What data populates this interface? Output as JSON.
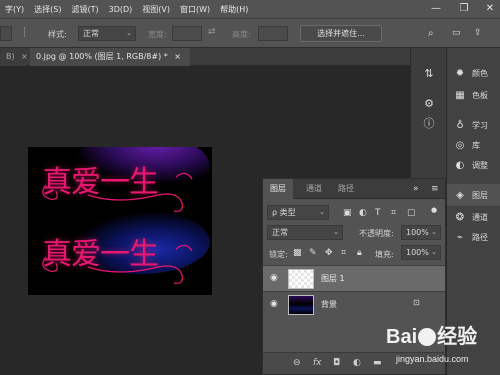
{
  "menu": {
    "items": [
      "字(Y)",
      "选择(S)",
      "滤镜(T)",
      "3D(D)",
      "视图(V)",
      "窗口(W)",
      "帮助(H)"
    ],
    "min": "—",
    "max": "❐",
    "close": "✕"
  },
  "options": {
    "style_label": "样式:",
    "style_value": "正常",
    "width_label": "宽度:",
    "height_label": "高度:",
    "mask_button": "选择并遮住..."
  },
  "tabs": {
    "prev_tab": "B)",
    "active_tab": "0.jpg @ 100% (图层 1, RGB/8#) *"
  },
  "document": {
    "text_top": "真爱一生",
    "text_bottom": "真爱一生",
    "text_color": "#e8176f",
    "glow_top": "#6a1fb0",
    "glow_bottom": "#1a2aa8"
  },
  "right_panels": {
    "items": [
      {
        "icon": "palette-icon",
        "label": "颜色"
      },
      {
        "icon": "swatches-icon",
        "label": "色板"
      },
      {
        "icon": "lightbulb-icon",
        "label": "学习"
      },
      {
        "icon": "library-icon",
        "label": "库"
      },
      {
        "icon": "adjustments-icon",
        "label": "调整"
      },
      {
        "icon": "layers-icon",
        "label": "图层"
      },
      {
        "icon": "channels-icon",
        "label": "通道"
      },
      {
        "icon": "paths-icon",
        "label": "路径"
      }
    ]
  },
  "layers_panel": {
    "tabs": [
      "图层",
      "通道",
      "路径"
    ],
    "filter_label": "ρ 类型",
    "blend_mode": "正常",
    "opacity_label": "不透明度:",
    "opacity_value": "100%",
    "lock_label": "锁定:",
    "fill_label": "填充:",
    "fill_value": "100%",
    "layers": [
      {
        "name": "图层 1",
        "selected": true
      },
      {
        "name": "背景",
        "selected": false
      }
    ],
    "footer_fx": "fx"
  },
  "watermark": {
    "brand_a": "Bai",
    "brand_b": "经验",
    "url": "jingyan.baidu.com"
  }
}
